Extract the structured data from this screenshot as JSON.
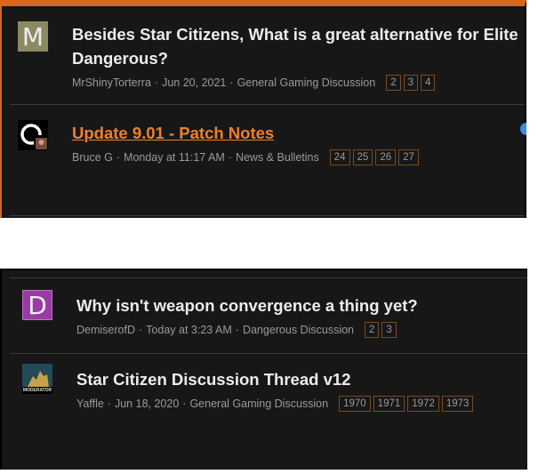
{
  "threads": [
    {
      "avatar_letter": "M",
      "avatar_color": "#8c8a63",
      "title": "Besides Star Citizens, What is a great alternative for Elite Dangerous?",
      "author": "MrShinyTorterra",
      "date": "Jun 20, 2021",
      "forum": "General Gaming Discussion",
      "pages": [
        "2",
        "3",
        "4"
      ]
    },
    {
      "avatar_icon": "circle-logo-icon",
      "title": "Update 9.01 - Patch Notes",
      "author": "Bruce G",
      "date": "Monday at 11:17 AM",
      "forum": "News & Bulletins",
      "pages": [
        "24",
        "25",
        "26",
        "27"
      ]
    },
    {
      "avatar_letter": "D",
      "avatar_color": "#9a3aa5",
      "title": "Why isn't weapon convergence a thing yet?",
      "author": "DemiserofD",
      "date": "Today at 3:23 AM",
      "forum": "Dangerous Discussion",
      "pages": [
        "2",
        "3"
      ]
    },
    {
      "avatar_icon": "moderator-avatar-icon",
      "avatar_badge": "MODERATOR",
      "title": "Star Citizen Discussion Thread v12",
      "author": "Yaffle",
      "date": "Jun 18, 2020",
      "forum": "General Gaming Discussion",
      "pages": [
        "1970",
        "1971",
        "1972",
        "1973"
      ]
    }
  ],
  "colors": {
    "accent": "#d5681d",
    "link": "#f0802a",
    "background": "#171717"
  }
}
